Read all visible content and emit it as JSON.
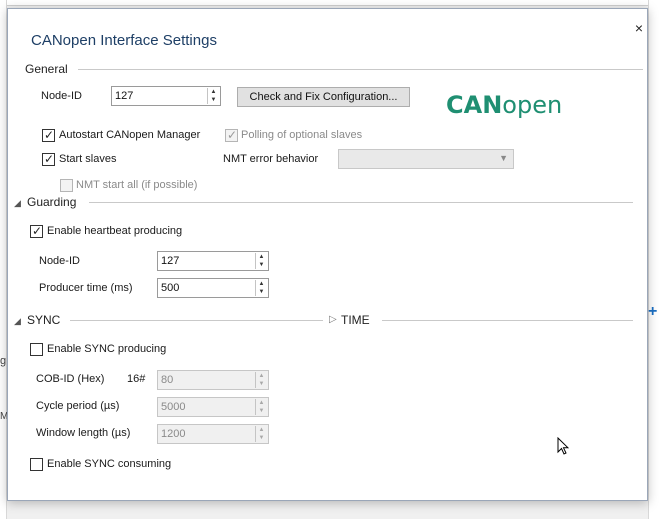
{
  "dialog": {
    "title": "CANopen Interface Settings",
    "close_glyph": "×"
  },
  "background": {
    "frag_g": "g",
    "frag_ma": "Ma",
    "plus_glyph": "+"
  },
  "general": {
    "header": "General",
    "node_id_label": "Node-ID",
    "node_id_value": "127",
    "check_button": "Check and Fix Configuration...",
    "logo_can": "CAN",
    "logo_open": "open",
    "autostart_label": "Autostart CANopen Manager",
    "autostart_checked": true,
    "polling_label": "Polling of optional slaves",
    "polling_checked": true,
    "start_slaves_label": "Start slaves",
    "start_slaves_checked": true,
    "nmt_error_label": "NMT error behavior",
    "nmt_error_value": "",
    "nmt_start_all_label": "NMT start all (if possible)",
    "nmt_start_all_checked": false
  },
  "guarding": {
    "header": "Guarding",
    "heartbeat_label": "Enable heartbeat producing",
    "heartbeat_checked": true,
    "node_id_label": "Node-ID",
    "node_id_value": "127",
    "producer_time_label": "Producer time (ms)",
    "producer_time_value": "500"
  },
  "sync": {
    "header": "SYNC",
    "time_header": "TIME",
    "sync_producing_label": "Enable SYNC producing",
    "sync_producing_checked": false,
    "cob_id_label": "COB-ID (Hex)",
    "cob_id_prefix": "16#",
    "cob_id_value": "80",
    "cycle_period_label": "Cycle period (µs)",
    "cycle_period_value": "5000",
    "window_length_label": "Window length (µs)",
    "window_length_value": "1200",
    "sync_consuming_label": "Enable SYNC consuming",
    "sync_consuming_checked": false
  },
  "colors": {
    "title": "#1e3f66",
    "logo": "#1f8f72",
    "accent": "#1b6fc4"
  },
  "icons": {
    "close": "close-icon",
    "collapse": "collapse-triangle-icon",
    "expand": "expand-triangle-icon",
    "spin_up": "spin-up-icon",
    "spin_down": "spin-down-icon",
    "dropdown": "chevron-down-icon",
    "cursor": "mouse-cursor-icon"
  }
}
